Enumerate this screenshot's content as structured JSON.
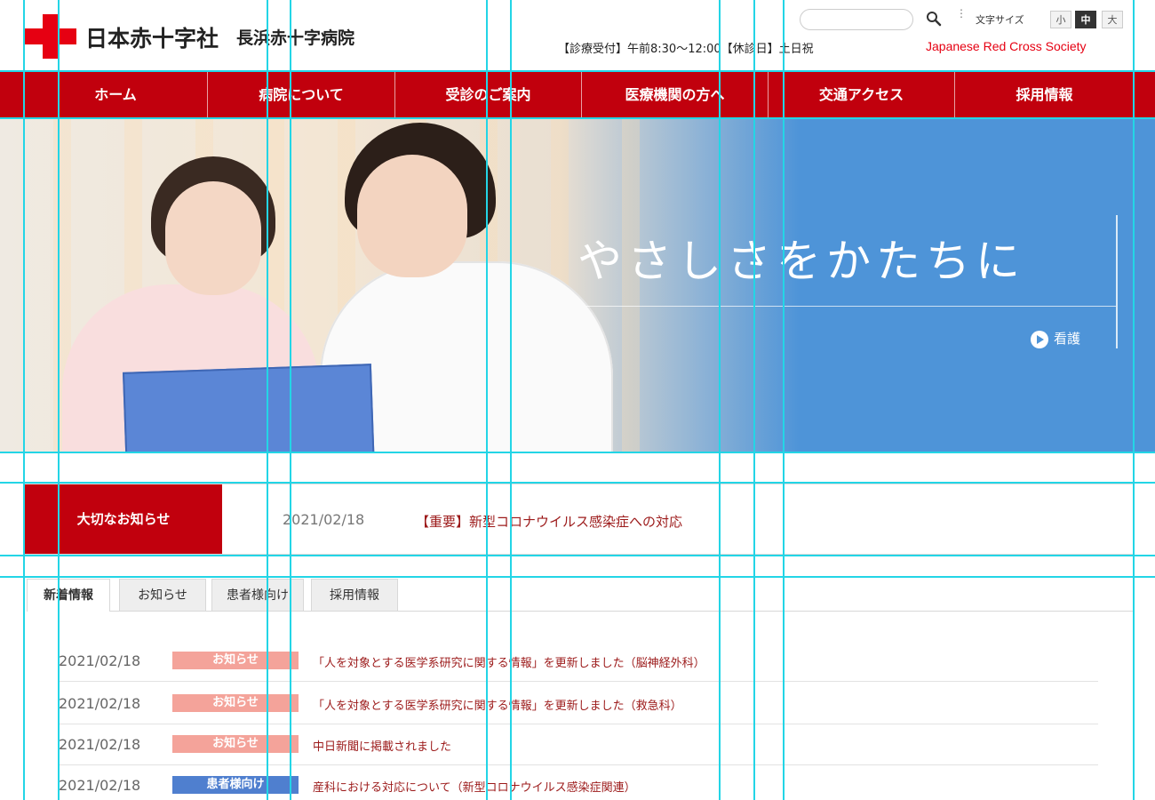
{
  "header": {
    "org_name": "日本赤十字社",
    "hospital_name": "長浜赤十字病院",
    "search_placeholder": "",
    "font_size_label": "文字サイズ",
    "font_sizes": [
      "小",
      "中",
      "大"
    ],
    "font_size_selected": "中",
    "hours": "【診療受付】午前8:30〜12:00【休診日】土日祝",
    "brand_en": "Japanese Red Cross Society",
    "brand_color": "#e60012"
  },
  "nav": {
    "items": [
      "ホーム",
      "病院について",
      "受診のご案内",
      "医療機関の方へ",
      "交通アクセス",
      "採用情報"
    ],
    "bg_color": "#c1000d"
  },
  "hero": {
    "catch_copy": "やさしさをかたちに",
    "link_label": "看護",
    "bg_color": "#4e94d8"
  },
  "notice": {
    "label": "大切なお知らせ",
    "date": "2021/02/18",
    "title": "【重要】新型コロナウイルス感染症への対応"
  },
  "tabs": {
    "items": [
      "新着情報",
      "お知らせ",
      "患者様向け",
      "採用情報"
    ],
    "active": "新着情報"
  },
  "news": [
    {
      "date": "2021/02/18",
      "badge": "お知らせ",
      "badge_color": "#f4a39a",
      "title": "「人を対象とする医学系研究に関する情報」を更新しました（脳神経外科）"
    },
    {
      "date": "2021/02/18",
      "badge": "お知らせ",
      "badge_color": "#f4a39a",
      "title": "「人を対象とする医学系研究に関する情報」を更新しました（救急科）"
    },
    {
      "date": "2021/02/18",
      "badge": "お知らせ",
      "badge_color": "#f4a39a",
      "title": "中日新聞に掲載されました"
    },
    {
      "date": "2021/02/18",
      "badge": "患者様向け",
      "badge_color": "#4f7fcf",
      "title": "産科における対応について（新型コロナウイルス感染症関連）"
    }
  ]
}
